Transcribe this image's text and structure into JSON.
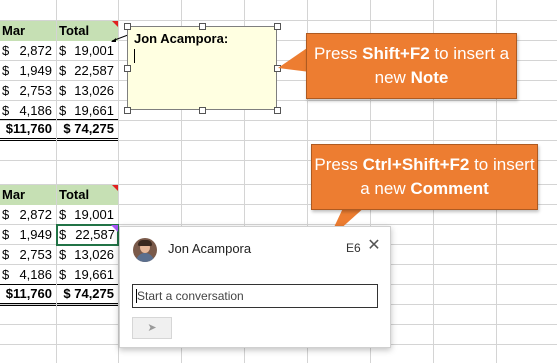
{
  "table1": {
    "headers": {
      "mar": "Mar",
      "total": "Total"
    },
    "rows": [
      {
        "mar": "2,872",
        "total": "19,001"
      },
      {
        "mar": "1,949",
        "total": "22,587"
      },
      {
        "mar": "2,753",
        "total": "13,026"
      },
      {
        "mar": "4,186",
        "total": "19,661"
      }
    ],
    "totals": {
      "mar": "$11,760",
      "total": "$ 74,275"
    },
    "currency": "$"
  },
  "table2": {
    "headers": {
      "mar": "Mar",
      "total": "Total"
    },
    "rows": [
      {
        "mar": "2,872",
        "total": "19,001"
      },
      {
        "mar": "1,949",
        "total": "22,587"
      },
      {
        "mar": "2,753",
        "total": "13,026"
      },
      {
        "mar": "4,186",
        "total": "19,661"
      }
    ],
    "totals": {
      "mar": "$11,760",
      "total": "$ 74,275"
    },
    "currency": "$"
  },
  "note": {
    "author": "Jon Acampora:"
  },
  "callout_note": {
    "pre": "Press ",
    "keys": "Shift+F2",
    "mid": " to insert a new ",
    "kind": "Note"
  },
  "callout_comment": {
    "pre": "Press ",
    "keys": "Ctrl+Shift+F2",
    "mid": " to insert a new ",
    "kind": "Comment"
  },
  "comment": {
    "author": "Jon Acampora",
    "cell_ref": "E6",
    "close_glyph": "✕",
    "placeholder": "Start a conversation",
    "send_glyph": "➤"
  },
  "colors": {
    "header_fill": "#c6e0b4",
    "callout": "#ed7d31",
    "note_fill": "#ffffe1",
    "selection": "#217346"
  }
}
